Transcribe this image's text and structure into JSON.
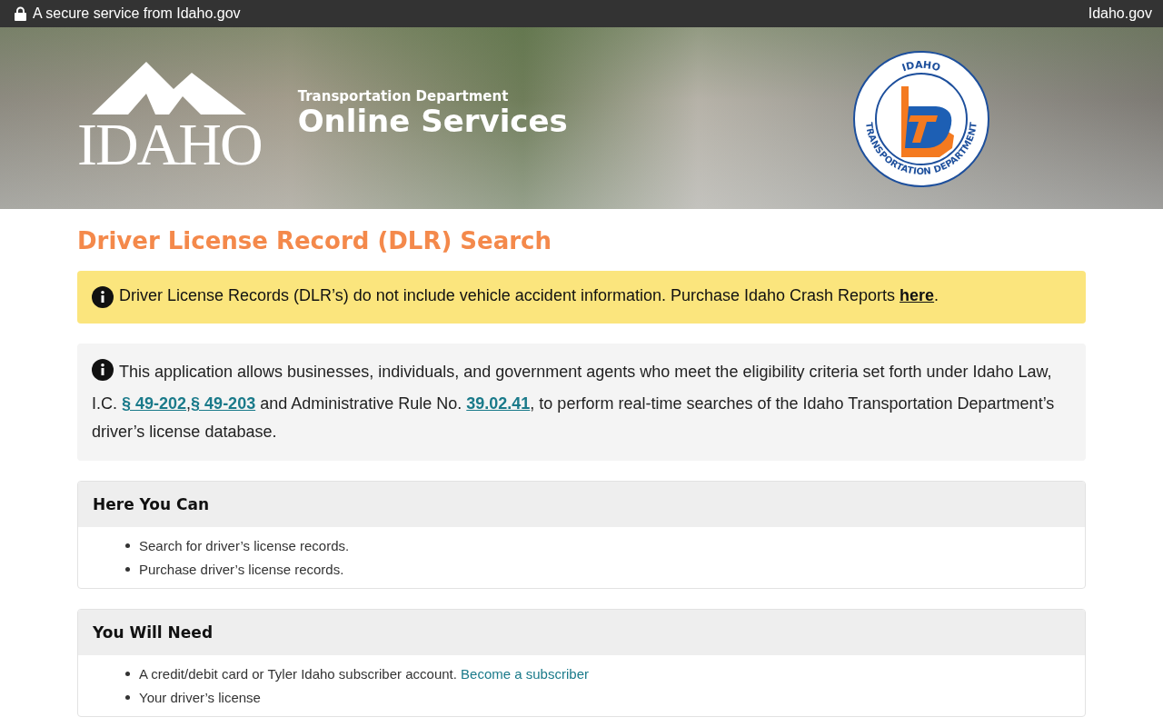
{
  "top_bar": {
    "notice": "A secure service from Idaho.gov",
    "link": "Idaho.gov"
  },
  "banner": {
    "logo_text": "IDAHO",
    "department": "Transportation Department",
    "title": "Online Services",
    "seal_top": "IDAHO",
    "seal_bottom": "TRANSPORTATION DEPARTMENT"
  },
  "page_title": "Driver License Record (DLR) Search",
  "alert": {
    "text": "Driver License Records (DLR’s) do not include vehicle accident information. Purchase Idaho Crash Reports ",
    "link": "here",
    "after": "."
  },
  "info": {
    "parts": [
      {
        "kind": "text",
        "text": "This application allows businesses, individuals, and government agents who meet the eligibility criteria set forth under Idaho Law, I.C. "
      },
      {
        "kind": "link",
        "text": "§ 49-202"
      },
      {
        "kind": "text",
        "text": ","
      },
      {
        "kind": "link",
        "text": "§ 49-203"
      },
      {
        "kind": "text",
        "text": " and Administrative Rule No. "
      },
      {
        "kind": "link",
        "text": "39.02.41"
      },
      {
        "kind": "text",
        "text": ", to perform real-time searches of the Idaho Transportation Department’s driver’s license database."
      }
    ]
  },
  "cards": [
    {
      "title": "Here You Can",
      "items": [
        {
          "text": "Search for driver’s license records."
        },
        {
          "text": "Purchase driver’s license records."
        }
      ]
    },
    {
      "title": "You Will Need",
      "items": [
        {
          "text": "A credit/debit card or Tyler Idaho subscriber account. ",
          "link": "Become a subscriber"
        },
        {
          "text": "Your driver’s license"
        }
      ]
    }
  ]
}
